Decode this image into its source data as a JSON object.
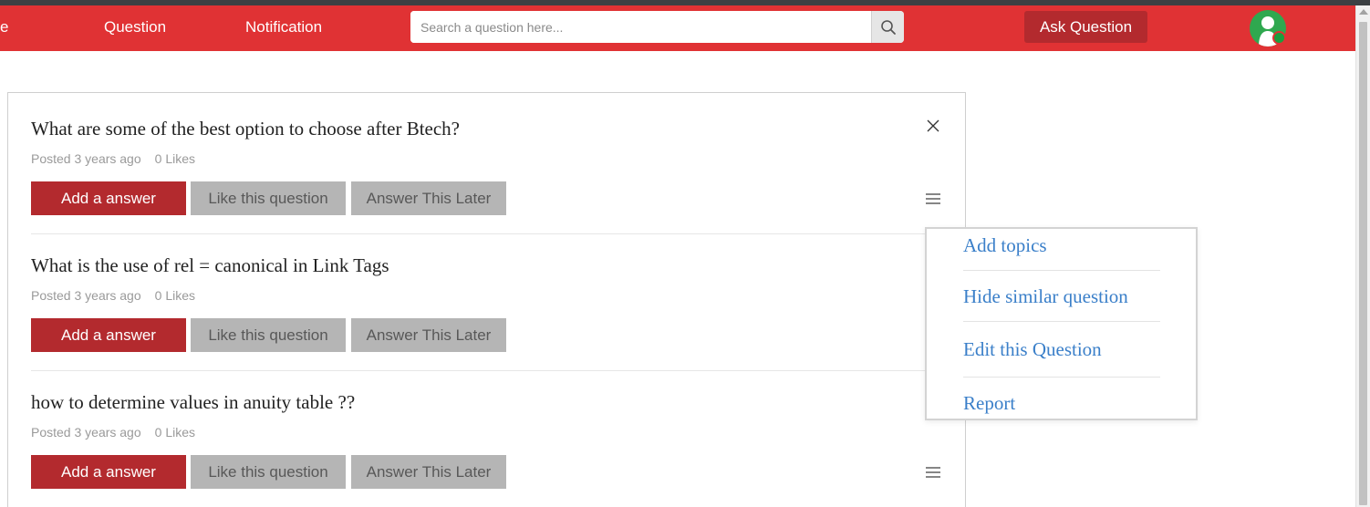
{
  "nav": {
    "home_fragment": "e",
    "question_label": "Question",
    "notification_label": "Notification",
    "ask_label": "Ask Question"
  },
  "search": {
    "placeholder": "Search a question here...",
    "value": ""
  },
  "icons": {
    "search": "search-icon",
    "close": "close-icon",
    "menu": "hamburger-menu-icon",
    "avatar": "user-avatar-icon"
  },
  "colors": {
    "navbar": "#e03234",
    "primary_button": "#b32a2e",
    "secondary_button": "#b5b5b5",
    "link": "#3a7fc9"
  },
  "questions": [
    {
      "title": "What are some of the best option to choose after Btech?",
      "posted": "Posted 3 years ago",
      "likes": "0 Likes",
      "answer_label": "Add a answer",
      "like_label": "Like this question",
      "later_label": "Answer This Later"
    },
    {
      "title": "What is the use of rel = canonical in Link Tags",
      "posted": "Posted 3 years ago",
      "likes": "0 Likes",
      "answer_label": "Add a answer",
      "like_label": "Like this question",
      "later_label": "Answer This Later"
    },
    {
      "title": "how to determine values in anuity table ??",
      "posted": "Posted 3 years ago",
      "likes": "0 Likes",
      "answer_label": "Add a answer",
      "like_label": "Like this question",
      "later_label": "Answer This Later"
    }
  ],
  "menu": {
    "items": [
      "Add topics",
      "Hide similar question",
      "Edit this Question",
      "Report"
    ]
  }
}
